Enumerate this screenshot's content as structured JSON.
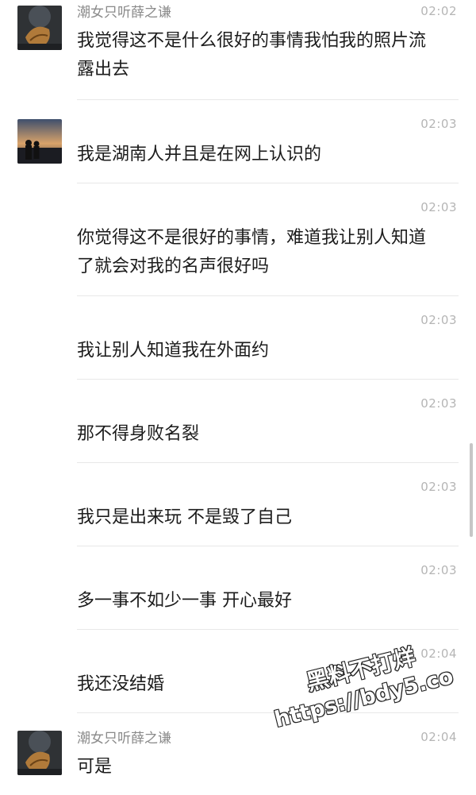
{
  "chat": {
    "messages": [
      {
        "sender": "潮女只听薛之谦",
        "time": "02:02",
        "text": "我觉得这不是什么很好的事情我怕我的照片流露出去",
        "avatar": "dark-leaf-avatar"
      },
      {
        "sender": "",
        "time": "02:03",
        "text": "我是湖南人并且是在网上认识的",
        "avatar": "sunset-silhouette-avatar"
      },
      {
        "sender": "",
        "time": "02:03",
        "text": "你觉得这不是很好的事情，难道我让别人知道了就会对我的名声很好吗",
        "avatar": ""
      },
      {
        "sender": "",
        "time": "02:03",
        "text": "我让别人知道我在外面约",
        "avatar": ""
      },
      {
        "sender": "",
        "time": "02:03",
        "text": "那不得身败名裂",
        "avatar": ""
      },
      {
        "sender": "",
        "time": "02:03",
        "text": "我只是出来玩 不是毁了自己",
        "avatar": ""
      },
      {
        "sender": "",
        "time": "02:03",
        "text": "多一事不如少一事 开心最好",
        "avatar": ""
      },
      {
        "sender": "",
        "time": "02:04",
        "text": "我还没结婚",
        "avatar": ""
      },
      {
        "sender": "潮女只听薛之谦",
        "time": "02:04",
        "text": "可是",
        "avatar": "dark-leaf-avatar"
      }
    ]
  },
  "watermark": {
    "line1": "黑料不打烊",
    "line2": "https://bdy5.co"
  },
  "colors": {
    "background": "#ffffff",
    "text": "#1c1c1c",
    "sender": "#8a8a8a",
    "time": "#b5b5b5",
    "divider": "#e8e8e8"
  }
}
